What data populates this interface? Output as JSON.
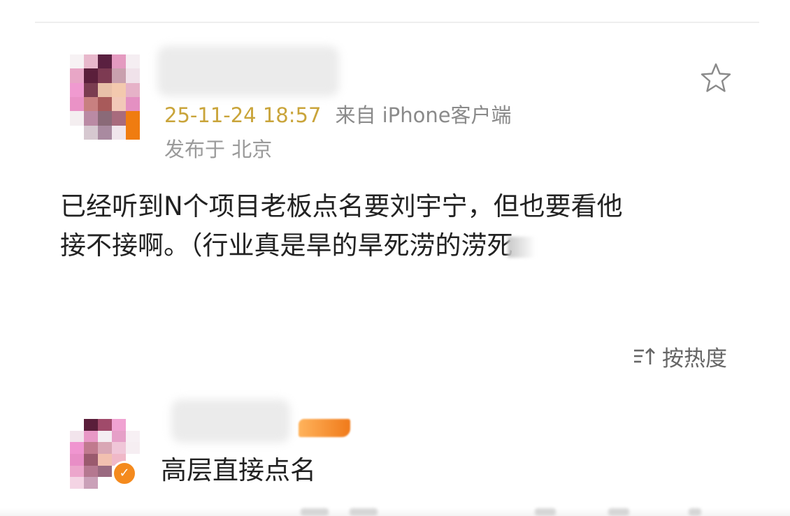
{
  "post": {
    "timestamp": "25-11-24 18:57",
    "source": "来自 iPhone客户端",
    "location": "发布于 北京",
    "content_lines": [
      "已经听到N个项目老板点名要刘宇宁，但也要看他",
      "接不接啊。（行业真是旱的旱死涝的涝死"
    ],
    "favorite_icon": "star-outline-icon"
  },
  "comments": {
    "sort_label": "按热度",
    "sort_icon": "sort-icon",
    "items": [
      {
        "text": "高层直接点名",
        "badge_icon": "verified-check-icon"
      }
    ]
  },
  "colors": {
    "timestamp": "#c9a43a",
    "meta": "#8a8a8a",
    "body_text": "#222222",
    "verify_badge": "#f48a1e",
    "vip_badge": "#f07a1a"
  }
}
